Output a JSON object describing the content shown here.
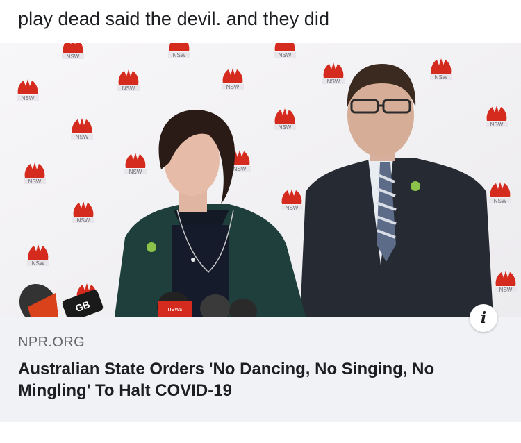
{
  "post": {
    "caption": "play dead said the devil. and they did"
  },
  "link_preview": {
    "domain": "NPR.ORG",
    "headline": "Australian State Orders 'No Dancing, No Singing, No Mingling' To Halt COVID-19",
    "info_icon": "info-icon",
    "backdrop_logo_text": "NSW",
    "mic_logo_text": "news",
    "colors": {
      "card_background": "#f0f2f5",
      "domain_text": "#65676b",
      "headline_text": "#1c1e21",
      "nsw_red": "#d52b1e"
    }
  }
}
